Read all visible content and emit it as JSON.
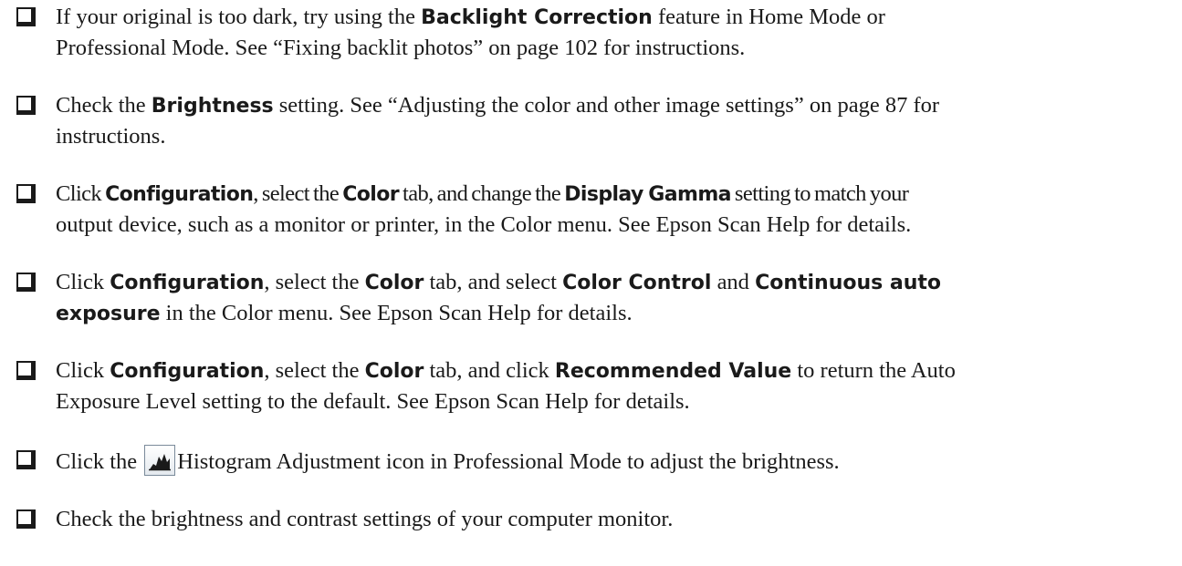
{
  "items": [
    {
      "lines": [
        [
          "If your original is too dark, try using the ",
          "Backlight Correction",
          " feature in Home Mode or"
        ],
        [
          "Professional Mode. See “Fixing backlit photos” on page 102 for instructions."
        ]
      ]
    },
    {
      "lines": [
        [
          "Check the ",
          "Brightness",
          " setting. See “Adjusting the color and other image settings” on page 87 for"
        ],
        [
          "instructions."
        ]
      ]
    },
    {
      "lines": [
        [
          "Click ",
          "Configuration",
          ", select the ",
          "Color",
          " tab, and change the ",
          "Display Gamma",
          " setting to match your"
        ],
        [
          "output device, such as a monitor or printer, in the Color menu. See Epson Scan Help for details."
        ]
      ]
    },
    {
      "lines": [
        [
          "Click ",
          "Configuration",
          ", select the ",
          "Color",
          " tab, and select ",
          "Color Control",
          " and ",
          "Continuous auto"
        ],
        [
          "exposure",
          " in the Color menu. See Epson Scan Help for details."
        ]
      ]
    },
    {
      "lines": [
        [
          "Click ",
          "Configuration",
          ", select the ",
          "Color",
          " tab, and click ",
          "Recommended Value",
          " to return the Auto"
        ],
        [
          "Exposure Level setting to the default. See Epson Scan Help for details."
        ]
      ]
    },
    {
      "lines": [
        [
          "Click the ",
          "Histogram Adjustment icon in Professional Mode to adjust the brightness."
        ]
      ],
      "icon": "histogram-adjustment-icon"
    },
    {
      "lines": [
        [
          "Check the brightness and contrast settings of your computer monitor."
        ]
      ]
    }
  ]
}
